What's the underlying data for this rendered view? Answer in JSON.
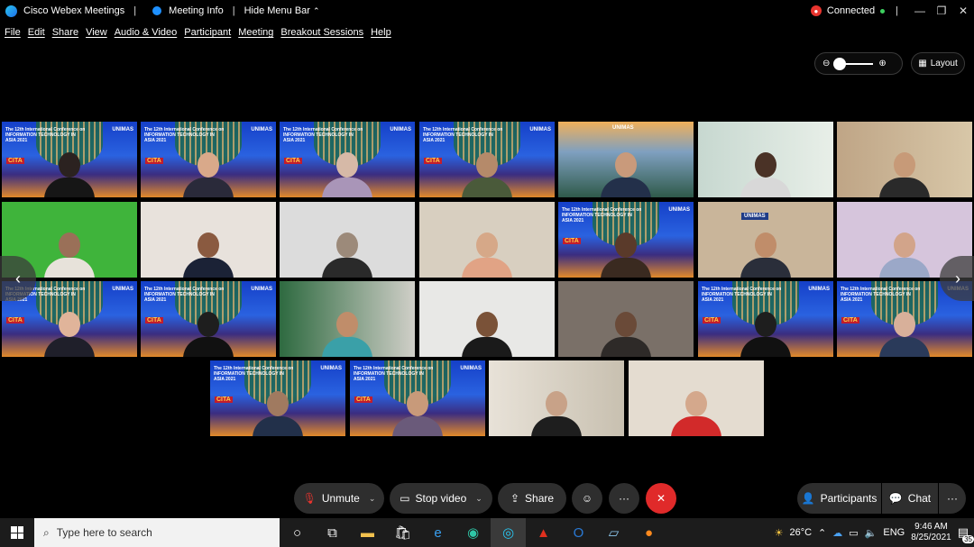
{
  "titlebar": {
    "app_title": "Cisco Webex Meetings",
    "meeting_info": "Meeting Info",
    "hide_menu": "Hide Menu Bar",
    "status": "Connected"
  },
  "menu": [
    "File",
    "Edit",
    "Share",
    "View",
    "Audio & Video",
    "Participant",
    "Meeting",
    "Breakout Sessions",
    "Help"
  ],
  "layout_label": "Layout",
  "conference": {
    "text": "The 12th International Conference on INFORMATION TECHNOLOGY IN ASIA 2021",
    "logo": "UNIMAS",
    "short": "CITA"
  },
  "controls": {
    "unmute": "Unmute",
    "stop_video": "Stop video",
    "share": "Share",
    "participants": "Participants",
    "chat": "Chat"
  },
  "taskbar": {
    "search_placeholder": "Type here to search",
    "weather": "26°C",
    "lang": "ENG",
    "time": "9:46 AM",
    "date": "8/25/2021",
    "notifications": "35"
  }
}
